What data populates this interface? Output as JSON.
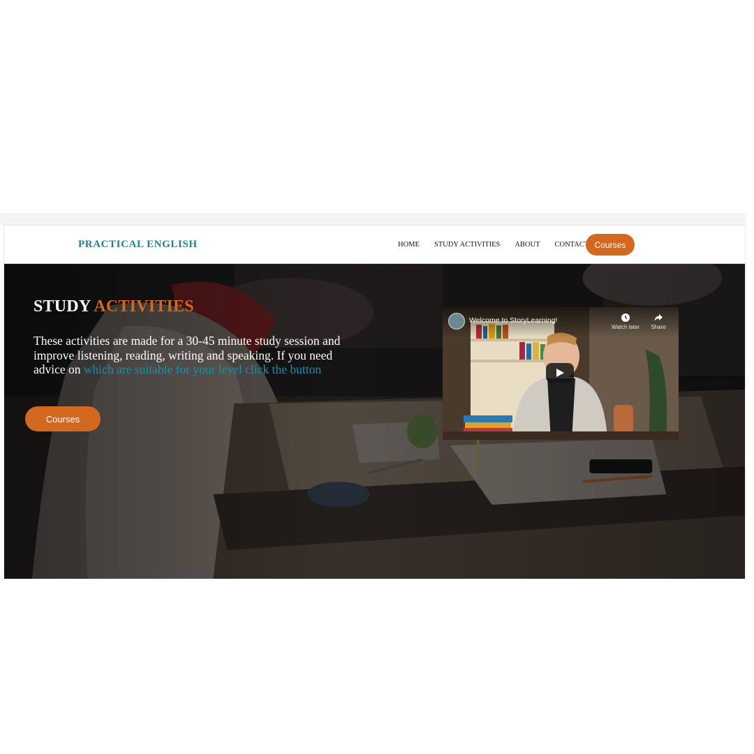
{
  "nav": {
    "brand": "PRACTICAL ENGLISH",
    "links": [
      "HOME",
      "STUDY ACTIVITIES",
      "ABOUT",
      "CONTACT"
    ],
    "cta_label": "Courses"
  },
  "hero": {
    "title_part1": "STUDY",
    "title_part2": "ACTIVITIES",
    "text": "These activities are made for a 30-45 minute study session and improve listening, reading, writing and speaking. If you need advice on",
    "link_text": "which are suitable for your level click the button",
    "button_label": "Courses"
  },
  "video": {
    "title": "Welcome to StoryLearning!",
    "watch_later_label": "Watch later",
    "share_label": "Share"
  },
  "colors": {
    "accent": "#d2691e",
    "brand": "#1a7f97",
    "link": "#1a8fb0"
  }
}
